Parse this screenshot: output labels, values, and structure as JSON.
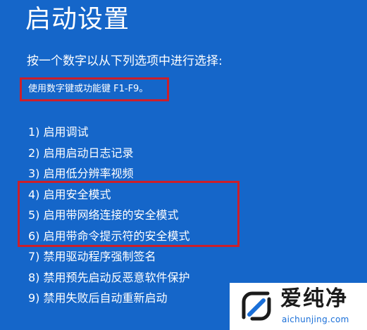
{
  "screen": {
    "title": "启动设置",
    "instruction": "按一个数字以从下列选项中进行选择:",
    "hint": "使用数字键或功能键 F1-F9。",
    "options": [
      {
        "label": "1) 启用调试"
      },
      {
        "label": "2) 启用启动日志记录"
      },
      {
        "label": "3) 启用低分辨率视频"
      },
      {
        "label": "4) 启用安全模式"
      },
      {
        "label": "5) 启用带网络连接的安全模式"
      },
      {
        "label": "6) 启用带命令提示符的安全模式"
      },
      {
        "label": "7) 禁用驱动程序强制签名"
      },
      {
        "label": "8) 禁用预先启动反恶意软件保护"
      },
      {
        "label": "9) 禁用失败后自动重新启动"
      }
    ]
  },
  "watermark": {
    "brand": "爱纯净",
    "url": "aichunjing.com",
    "logo_icon": "aichunjing-logo-icon"
  },
  "colors": {
    "background": "#1566c9",
    "text": "#ffffff",
    "annotation_box": "#cc1f2a",
    "watermark_text": "#1b1b1b",
    "watermark_url": "#1a6fd8"
  }
}
